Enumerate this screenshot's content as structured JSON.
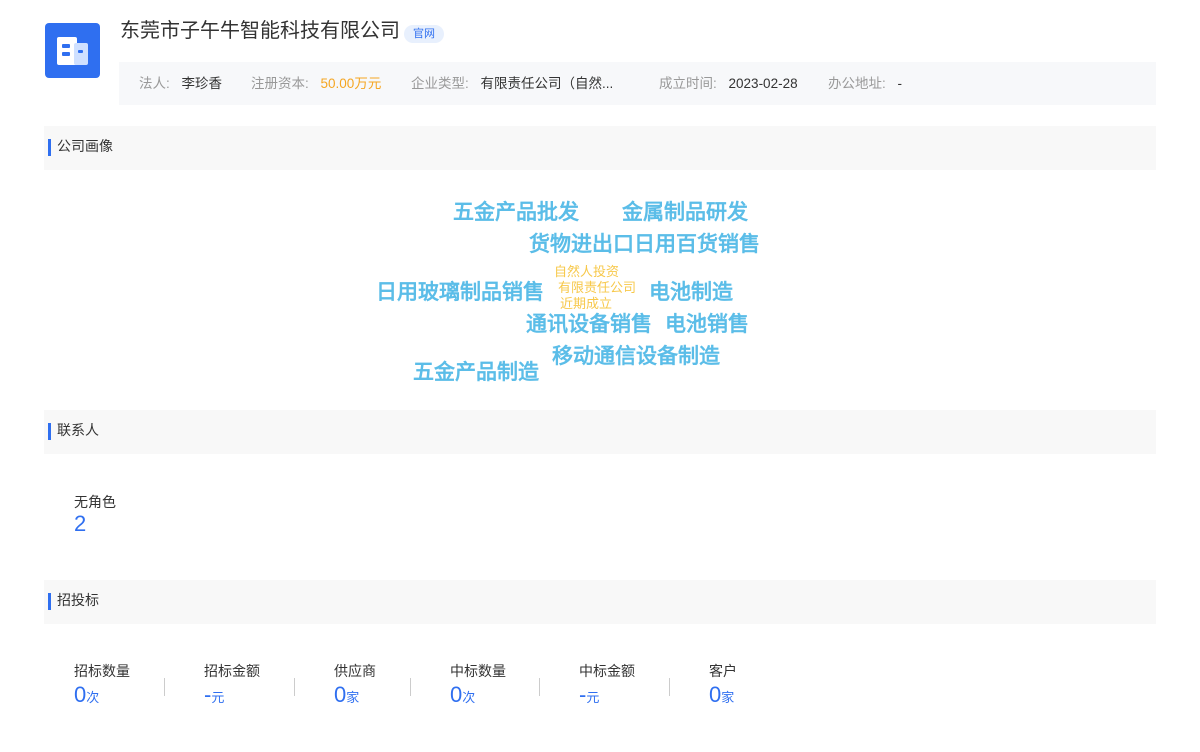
{
  "company": {
    "name": "东莞市子午牛智能科技有限公司",
    "badge": "官网"
  },
  "info": {
    "legal_label": "法人:",
    "legal_value": "李珍香",
    "capital_label": "注册资本:",
    "capital_value": "50.00万元",
    "type_label": "企业类型:",
    "type_value": "有限责任公司（自然...",
    "founded_label": "成立时间:",
    "founded_value": "2023-02-28",
    "address_label": "办公地址:",
    "address_value": "-"
  },
  "sections": {
    "portrait": "公司画像",
    "contacts": "联系人",
    "bidding": "招投标"
  },
  "word_cloud": [
    "五金产品批发",
    "金属制品研发",
    "货物进出口日用百货销售",
    "自然人投资",
    "有限责任公司",
    "近期成立",
    "日用玻璃制品销售",
    "电池制造",
    "通讯设备销售",
    "电池销售",
    "移动通信设备制造",
    "五金产品制造"
  ],
  "contacts": {
    "role_label": "无角色",
    "role_count": "2"
  },
  "bidding_stats": [
    {
      "label": "招标数量",
      "value": "0",
      "unit": "次"
    },
    {
      "label": "招标金额",
      "value": "-",
      "unit": "元"
    },
    {
      "label": "供应商",
      "value": "0",
      "unit": "家"
    },
    {
      "label": "中标数量",
      "value": "0",
      "unit": "次"
    },
    {
      "label": "中标金额",
      "value": "-",
      "unit": "元"
    },
    {
      "label": "客户",
      "value": "0",
      "unit": "家"
    }
  ],
  "colors": {
    "accent": "#2f6ff0",
    "cloud_blue": "#5bbde8",
    "cloud_yellow": "#f7c84a",
    "capital_orange": "#f5a623"
  },
  "icons": {
    "logo": "building-icon"
  }
}
